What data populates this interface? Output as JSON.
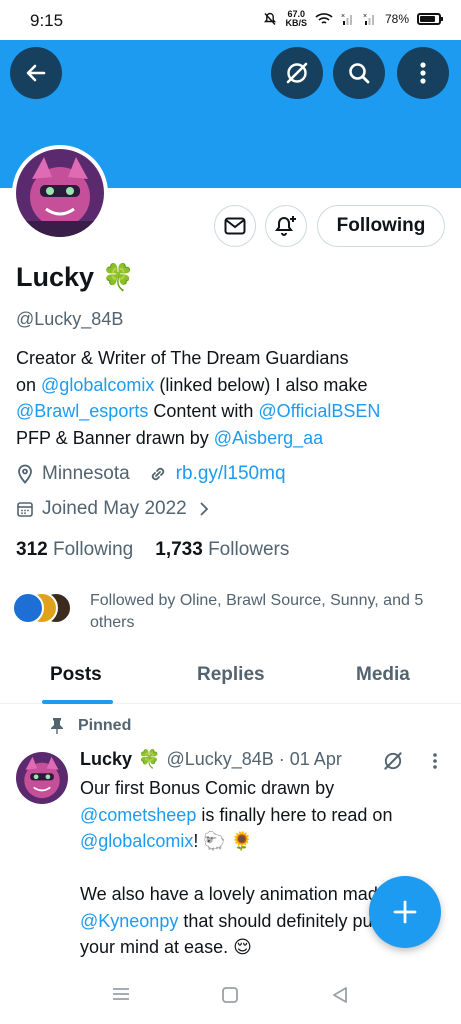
{
  "status_bar": {
    "time": "9:15",
    "speed_value": "67.0",
    "speed_unit": "KB/S",
    "battery": "78%"
  },
  "colors": {
    "banner": "#1d9bf0",
    "accent": "#1d9bf0",
    "button_dark": "#17405f"
  },
  "profile": {
    "name": "Lucky",
    "name_emoji": "🍀",
    "handle": "@Lucky_84B",
    "bio": {
      "line1": "Creator & Writer of The Dream Guardians",
      "line2_pre": "on ",
      "line2_link": "@globalcomix",
      "line2_post": " (linked below)  I also make",
      "line3_link1": "@Brawl_esports",
      "line3_mid": " Content with ",
      "line3_link2": "@OfficialBSEN",
      "line4_pre": "PFP & Banner drawn by ",
      "line4_link": "@Aisberg_aa"
    },
    "location": "Minnesota",
    "website": "rb.gy/l150mq",
    "joined": "Joined May 2022",
    "following_count": "312",
    "following_label": "Following",
    "followers_count": "1,733",
    "followers_label": "Followers",
    "followed_by": "Followed by Oline, Brawl Source, Sunny, and 5 others"
  },
  "actions": {
    "following_button": "Following"
  },
  "tabs": [
    {
      "label": "Posts"
    },
    {
      "label": "Replies"
    },
    {
      "label": "Media"
    }
  ],
  "post": {
    "pinned_label": "Pinned",
    "author_name": "Lucky",
    "author_emoji": "🍀",
    "author_meta": "@Lucky_84B · 01 Apr",
    "body": {
      "l1": "Our first Bonus Comic drawn by",
      "l2_link": "@cometsheep",
      "l2_post": " is finally here to read on",
      "l3_link": "@globalcomix",
      "l3_post": "! 🐑 🌻",
      "l5": "We also have a lovely animation made by",
      "l6_link": "@Kyneonpy",
      "l6_post": " that should definitely put",
      "l7": "your mind at ease. 😌"
    }
  }
}
